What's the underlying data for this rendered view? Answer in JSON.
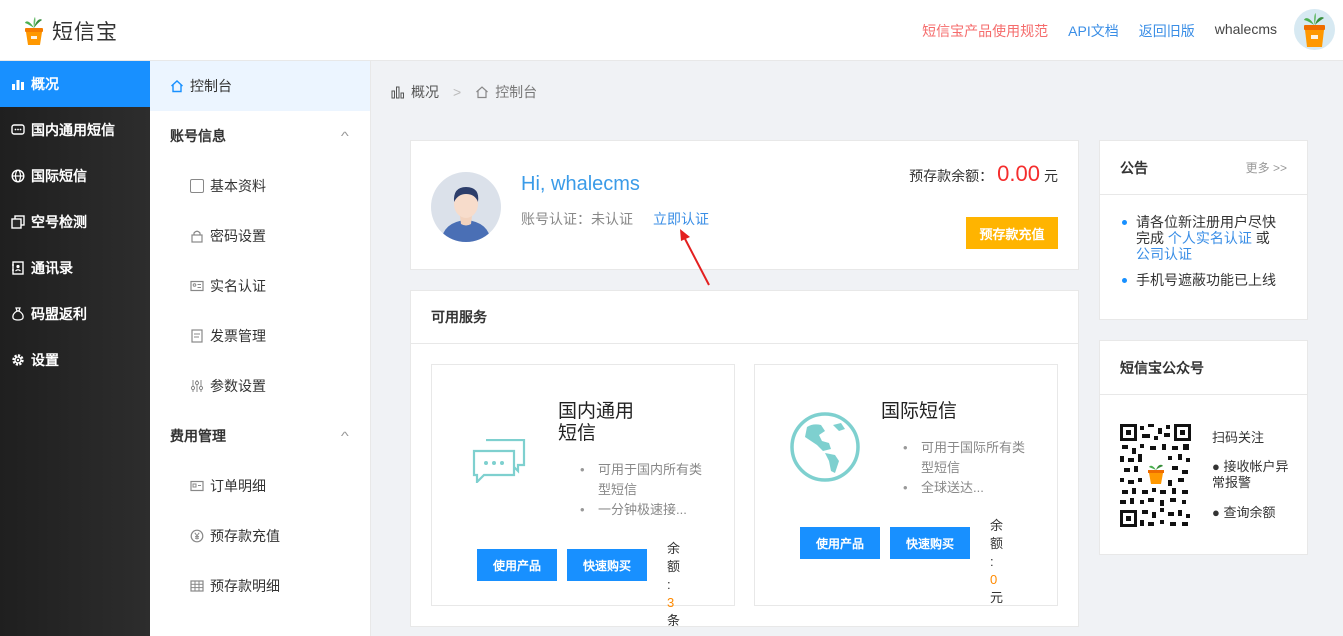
{
  "header": {
    "logo_text": "短信宝",
    "links": {
      "rules": "短信宝产品使用规范",
      "api": "API文档",
      "old": "返回旧版",
      "user": "whalecms"
    }
  },
  "sidebar": {
    "items": [
      {
        "label": "概况",
        "icon": "bar-chart-icon"
      },
      {
        "label": "国内通用短信",
        "icon": "message-icon"
      },
      {
        "label": "国际短信",
        "icon": "globe-icon"
      },
      {
        "label": "空号检测",
        "icon": "copy-check-icon"
      },
      {
        "label": "通讯录",
        "icon": "contacts-icon"
      },
      {
        "label": "码盟返利",
        "icon": "money-bag-icon"
      },
      {
        "label": "设置",
        "icon": "gear-icon"
      }
    ]
  },
  "subnav": {
    "active": "控制台",
    "group1": "账号信息",
    "group1_items": [
      "基本资料",
      "密码设置",
      "实名认证",
      "发票管理",
      "参数设置"
    ],
    "group2": "费用管理",
    "group2_items": [
      "订单明细",
      "预存款充值",
      "预存款明细"
    ]
  },
  "breadcrumb": {
    "root": "概况",
    "sep": ">",
    "current": "控制台"
  },
  "welcome": {
    "greeting": "Hi, whalecms",
    "cert_status": "账号认证：未认证",
    "cert_link": "立即认证",
    "balance_label": "预存款余额：",
    "balance_amount": "0.00",
    "balance_unit": "元",
    "recharge_button": "预存款充值"
  },
  "services": {
    "title": "可用服务",
    "domestic": {
      "title_line1": "国内通用",
      "title_line2": "短信",
      "features": [
        "可用于国内所有类型短信",
        "一分钟极速接..."
      ],
      "use_button": "使用产品",
      "buy_button": "快速购买",
      "remain_label": "余额:",
      "remain_value": "3",
      "remain_unit": "条"
    },
    "intl": {
      "title": "国际短信",
      "features": [
        "可用于国际所有类型短信",
        "全球送达..."
      ],
      "use_button": "使用产品",
      "buy_button": "快速购买",
      "remain_label": "余额:",
      "remain_value": "0",
      "remain_unit": "元"
    }
  },
  "notice": {
    "title": "公告",
    "more": "更多 >>",
    "item1_prefix": "请各位新注册用户尽快完成",
    "item1_link1": "个人实名认证",
    "item1_mid": "或",
    "item1_link2": "公司认证",
    "item2": "手机号遮蔽功能已上线"
  },
  "wechat": {
    "title": "短信宝公众号",
    "scan": "扫码关注",
    "feature1": "● 接收帐户异常报警",
    "feature2": "● 查询余额"
  },
  "colors": {
    "primary": "#1890ff",
    "accent_orange": "#ffb400",
    "balance_red": "#f52d2d",
    "remain_orange": "#ff8a00"
  }
}
